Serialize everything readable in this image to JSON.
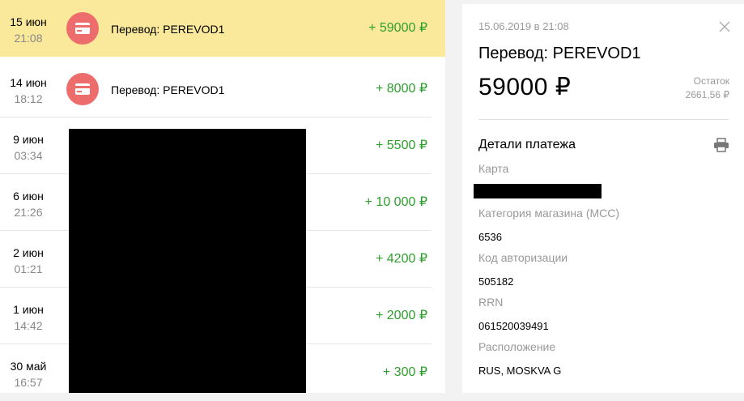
{
  "transactions": [
    {
      "date": "15 июн",
      "time": "21:08",
      "description": "Перевод: PEREVOD1",
      "amount": "+ 59000 ₽",
      "selected": true
    },
    {
      "date": "14 июн",
      "time": "18:12",
      "description": "Перевод: PEREVOD1",
      "amount": "+ 8000 ₽"
    },
    {
      "date": "9 июн",
      "time": "03:34",
      "description": "",
      "amount": "+ 5500 ₽"
    },
    {
      "date": "6 июн",
      "time": "21:26",
      "description": "",
      "amount": "+ 10 000 ₽"
    },
    {
      "date": "2 июн",
      "time": "01:21",
      "description": "",
      "amount": "+ 4200 ₽"
    },
    {
      "date": "1 июн",
      "time": "14:42",
      "description": "",
      "amount": "+ 2000 ₽"
    },
    {
      "date": "30 май",
      "time": "16:57",
      "description": "",
      "amount": "+ 300 ₽"
    }
  ],
  "detail": {
    "timestamp": "15.06.2019 в 21:08",
    "title": "Перевод: PEREVOD1",
    "amount": "59000 ₽",
    "balance_label": "Остаток",
    "balance_value": "2661,56 ₽",
    "section_title": "Детали платежа",
    "card_label": "Карта",
    "mcc_label": "Категория магазина (MCC)",
    "mcc_value": "6536",
    "auth_label": "Код авторизации",
    "auth_value": "505182",
    "rrn_label": "RRN",
    "rrn_value": "061520039491",
    "location_label": "Расположение",
    "location_value": "RUS, MOSKVA G"
  },
  "colors": {
    "selected_row": "#fbe99b",
    "positive_amount": "#2d9e2d",
    "transfer_icon": "#ec6d6b"
  },
  "icons": {
    "transfer": "card-icon",
    "close": "close-icon",
    "print": "printer-icon"
  }
}
